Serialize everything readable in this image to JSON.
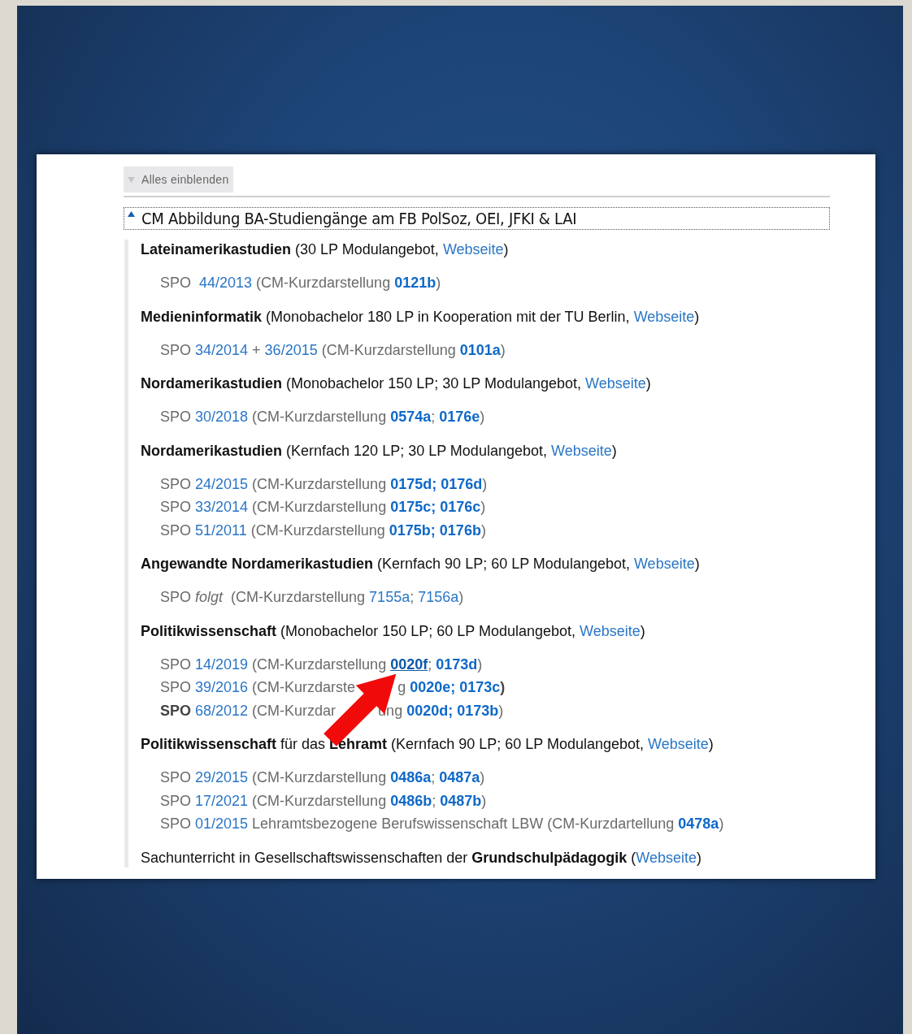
{
  "expand_all_button": {
    "label": "Alles einblenden"
  },
  "section": {
    "title": "CM Abbildung BA-Studiengänge am FB PolSoz, OEI, JFKI & LAI",
    "expanded": true,
    "programs": [
      {
        "heading": [
          {
            "text": "Lateinamerikastudien",
            "kind": "bold"
          },
          {
            "text": " (30 LP Modulangebot, ",
            "kind": "plain"
          },
          {
            "text": "Webseite",
            "kind": "link"
          },
          {
            "text": ")",
            "kind": "plain"
          }
        ],
        "regulations": [
          [
            {
              "text": "SPO  ",
              "kind": "plain"
            },
            {
              "text": "44/2013",
              "kind": "link"
            },
            {
              "text": " (CM-Kurzdarstellung ",
              "kind": "plain"
            },
            {
              "text": "0121b",
              "kind": "strong-link"
            },
            {
              "text": ")",
              "kind": "plain"
            }
          ]
        ]
      },
      {
        "heading": [
          {
            "text": "Medieninformatik",
            "kind": "bold"
          },
          {
            "text": " (Monobachelor 180 LP in Kooperation mit der TU Berlin, ",
            "kind": "plain"
          },
          {
            "text": "Webseite",
            "kind": "link"
          },
          {
            "text": ")",
            "kind": "plain"
          }
        ],
        "regulations": [
          [
            {
              "text": "SPO ",
              "kind": "plain"
            },
            {
              "text": "34/2014",
              "kind": "link"
            },
            {
              "text": " + ",
              "kind": "plain"
            },
            {
              "text": "36/2015",
              "kind": "link"
            },
            {
              "text": " (CM-Kurzdarstellung ",
              "kind": "plain"
            },
            {
              "text": "0101a",
              "kind": "strong-link"
            },
            {
              "text": ")",
              "kind": "plain"
            }
          ]
        ]
      },
      {
        "heading": [
          {
            "text": "Nordamerikastudien",
            "kind": "bold"
          },
          {
            "text": " (Monobachelor 150 LP; 30 LP Modulangebot, ",
            "kind": "plain"
          },
          {
            "text": "Webseite",
            "kind": "link"
          },
          {
            "text": ")",
            "kind": "plain"
          }
        ],
        "regulations": [
          [
            {
              "text": "SPO ",
              "kind": "plain"
            },
            {
              "text": "30/2018",
              "kind": "link"
            },
            {
              "text": " (CM-Kurzdarstellung ",
              "kind": "plain"
            },
            {
              "text": "0574a",
              "kind": "strong-link"
            },
            {
              "text": "; ",
              "kind": "plain"
            },
            {
              "text": "0176e",
              "kind": "strong-link"
            },
            {
              "text": ")",
              "kind": "plain"
            }
          ]
        ]
      },
      {
        "heading": [
          {
            "text": "Nordamerikastudien",
            "kind": "bold"
          },
          {
            "text": " (Kernfach 120 LP; 30 LP Modulangebot, ",
            "kind": "plain"
          },
          {
            "text": "Webseite",
            "kind": "link"
          },
          {
            "text": ")",
            "kind": "plain"
          }
        ],
        "regulations": [
          [
            {
              "text": "SPO ",
              "kind": "plain"
            },
            {
              "text": "24/2015",
              "kind": "link"
            },
            {
              "text": " (CM-Kurzdarstellung ",
              "kind": "plain"
            },
            {
              "text": "0175d; 0176d",
              "kind": "strong-link"
            },
            {
              "text": ")",
              "kind": "plain"
            }
          ],
          [
            {
              "text": "SPO ",
              "kind": "plain"
            },
            {
              "text": "33/2014",
              "kind": "link"
            },
            {
              "text": " (CM-Kurzdarstellung ",
              "kind": "plain"
            },
            {
              "text": "0175c; 0176c",
              "kind": "strong-link"
            },
            {
              "text": ")",
              "kind": "plain"
            }
          ],
          [
            {
              "text": "SPO ",
              "kind": "plain"
            },
            {
              "text": "51/2011",
              "kind": "link"
            },
            {
              "text": " (CM-Kurzdarstellung ",
              "kind": "plain"
            },
            {
              "text": "0175b; 0176b",
              "kind": "strong-link"
            },
            {
              "text": ")",
              "kind": "plain"
            }
          ]
        ]
      },
      {
        "heading": [
          {
            "text": "Angewandte Nordamerikastudien",
            "kind": "bold"
          },
          {
            "text": " (Kernfach 90 LP; 60 LP Modulangebot, ",
            "kind": "plain"
          },
          {
            "text": "Webseite",
            "kind": "link"
          },
          {
            "text": ")",
            "kind": "plain"
          }
        ],
        "regulations": [
          [
            {
              "text": "SPO ",
              "kind": "plain"
            },
            {
              "text": "folgt",
              "kind": "italic"
            },
            {
              "text": "  (CM-Kurzdarstellung ",
              "kind": "plain"
            },
            {
              "text": "7155a",
              "kind": "link"
            },
            {
              "text": "; ",
              "kind": "plain"
            },
            {
              "text": "7156a",
              "kind": "link"
            },
            {
              "text": ")",
              "kind": "plain"
            }
          ]
        ]
      },
      {
        "heading": [
          {
            "text": "Politikwissenschaft",
            "kind": "bold"
          },
          {
            "text": " (Monobachelor 150 LP; 60 LP Modulangebot, ",
            "kind": "plain"
          },
          {
            "text": "Webseite",
            "kind": "link"
          },
          {
            "text": ")",
            "kind": "plain"
          }
        ],
        "regulations": [
          [
            {
              "text": "SPO ",
              "kind": "plain"
            },
            {
              "text": "14/2019",
              "kind": "link"
            },
            {
              "text": " (CM-Kurzdarstellung ",
              "kind": "plain"
            },
            {
              "text": "0020f",
              "kind": "hovered-link"
            },
            {
              "text": "; ",
              "kind": "plain"
            },
            {
              "text": "0173d",
              "kind": "strong-link"
            },
            {
              "text": ")",
              "kind": "plain"
            }
          ],
          [
            {
              "text": "SPO ",
              "kind": "plain"
            },
            {
              "text": "39/2016",
              "kind": "link"
            },
            {
              "text": " (CM-Kurzdarste",
              "kind": "plain"
            },
            {
              "kind": "covered"
            },
            {
              "text": "g ",
              "kind": "plain"
            },
            {
              "text": "0020e; 0173c",
              "kind": "strong-link"
            },
            {
              "text": ")",
              "kind": "bold"
            }
          ],
          [
            {
              "text": "SPO ",
              "kind": "bold"
            },
            {
              "text": "68/2012",
              "kind": "link"
            },
            {
              "text": " (CM-Kurzdar",
              "kind": "plain"
            },
            {
              "kind": "covered"
            },
            {
              "text": "ung ",
              "kind": "plain"
            },
            {
              "text": "0020d; 0173b",
              "kind": "strong-link"
            },
            {
              "text": ")",
              "kind": "plain"
            }
          ]
        ]
      },
      {
        "heading": [
          {
            "text": "Politikwissenschaft",
            "kind": "bold"
          },
          {
            "text": " für das ",
            "kind": "plain"
          },
          {
            "text": "Lehramt",
            "kind": "bold"
          },
          {
            "text": " (Kernfach 90 LP; 60 LP Modulangebot, ",
            "kind": "plain"
          },
          {
            "text": "Webseite",
            "kind": "link"
          },
          {
            "text": ")",
            "kind": "plain"
          }
        ],
        "regulations": [
          [
            {
              "text": "SPO ",
              "kind": "plain"
            },
            {
              "text": "29/2015",
              "kind": "link"
            },
            {
              "text": " (CM-Kurzdarstellung ",
              "kind": "plain"
            },
            {
              "text": "0486a",
              "kind": "strong-link"
            },
            {
              "text": "; ",
              "kind": "plain"
            },
            {
              "text": "0487a",
              "kind": "strong-link"
            },
            {
              "text": ")",
              "kind": "plain"
            }
          ],
          [
            {
              "text": "SPO ",
              "kind": "plain"
            },
            {
              "text": "17/2021",
              "kind": "link"
            },
            {
              "text": " (CM-Kurzdarstellung ",
              "kind": "plain"
            },
            {
              "text": "0486b",
              "kind": "strong-link"
            },
            {
              "text": "; ",
              "kind": "plain"
            },
            {
              "text": "0487b",
              "kind": "strong-link"
            },
            {
              "text": ")",
              "kind": "plain"
            }
          ],
          [
            {
              "text": "SPO ",
              "kind": "plain"
            },
            {
              "text": "01/2015",
              "kind": "link"
            },
            {
              "text": " Lehramtsbezogene Berufswissenschaft LBW (CM-Kurzdartellung ",
              "kind": "plain"
            },
            {
              "text": "0478a",
              "kind": "strong-link"
            },
            {
              "text": ")",
              "kind": "plain"
            }
          ]
        ]
      },
      {
        "heading": [
          {
            "text": "Sachunterricht in Gesellschaftswissenschaften der ",
            "kind": "plain"
          },
          {
            "text": "Grundschulpädagogik",
            "kind": "bold"
          },
          {
            "text": " (",
            "kind": "plain"
          },
          {
            "text": "Webseite",
            "kind": "link"
          },
          {
            "text": ")",
            "kind": "plain"
          }
        ]
      }
    ]
  }
}
